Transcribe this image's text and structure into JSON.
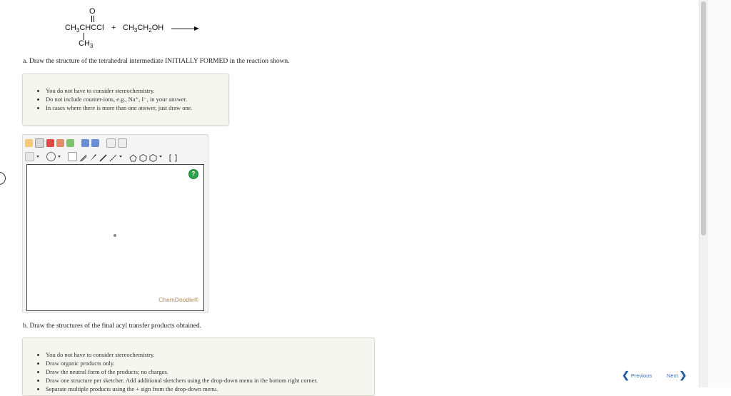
{
  "reaction": {
    "carbonyl_o": "O",
    "reactant_1": {
      "main": [
        "CH",
        "3",
        "CHCCl"
      ],
      "branch": [
        "CH",
        "3"
      ]
    },
    "plus": "+",
    "reactant_2": [
      "CH",
      "3",
      "CH",
      "2",
      "OH"
    ]
  },
  "part_a": {
    "prompt": "a. Draw the structure of the tetrahedral intermediate INITIALLY FORMED in the reaction shown.",
    "notes": [
      "You do not have to consider stereochemistry.",
      "Do not include counter-ions, e.g., Na⁺, I⁻, in your answer.",
      "In cases where there is more than one answer, just draw one."
    ]
  },
  "sketcher": {
    "help_label": "?",
    "watermark": "ChemDoodle®",
    "tool_icons_row1": [
      "hand-icon",
      "erase-icon",
      "pencil-icon",
      "undo-icon",
      "redo-icon",
      "zoom-in-icon",
      "zoom-out-icon",
      "clean-icon",
      "template-icon"
    ],
    "tool_icons_row2": [
      "atom-label-icon",
      "charge-icon",
      "single-bond-icon",
      "double-bond-icon",
      "wedge-bond-icon",
      "hash-bond-icon",
      "ring-cyclopropane-icon",
      "ring-benzene-icon",
      "ring-cyclohexane-icon",
      "bracket-icon"
    ]
  },
  "part_b": {
    "prompt": "b. Draw the structures of the final acyl transfer products obtained.",
    "notes": [
      "You do not have to consider stereochemistry.",
      "Draw organic products only.",
      "Draw the neutral form of the products; no charges.",
      "Draw one structure per sketcher. Add additional sketchers using the drop-down menu in the bottom right corner.",
      "Separate multiple products using the + sign from the drop-down menu."
    ]
  },
  "navigation": {
    "previous": "Previous",
    "next": "Next"
  },
  "colors": {
    "link": "#3a6fb0",
    "note_bg": "#f6f6f0",
    "help_green": "#2ea44f"
  }
}
